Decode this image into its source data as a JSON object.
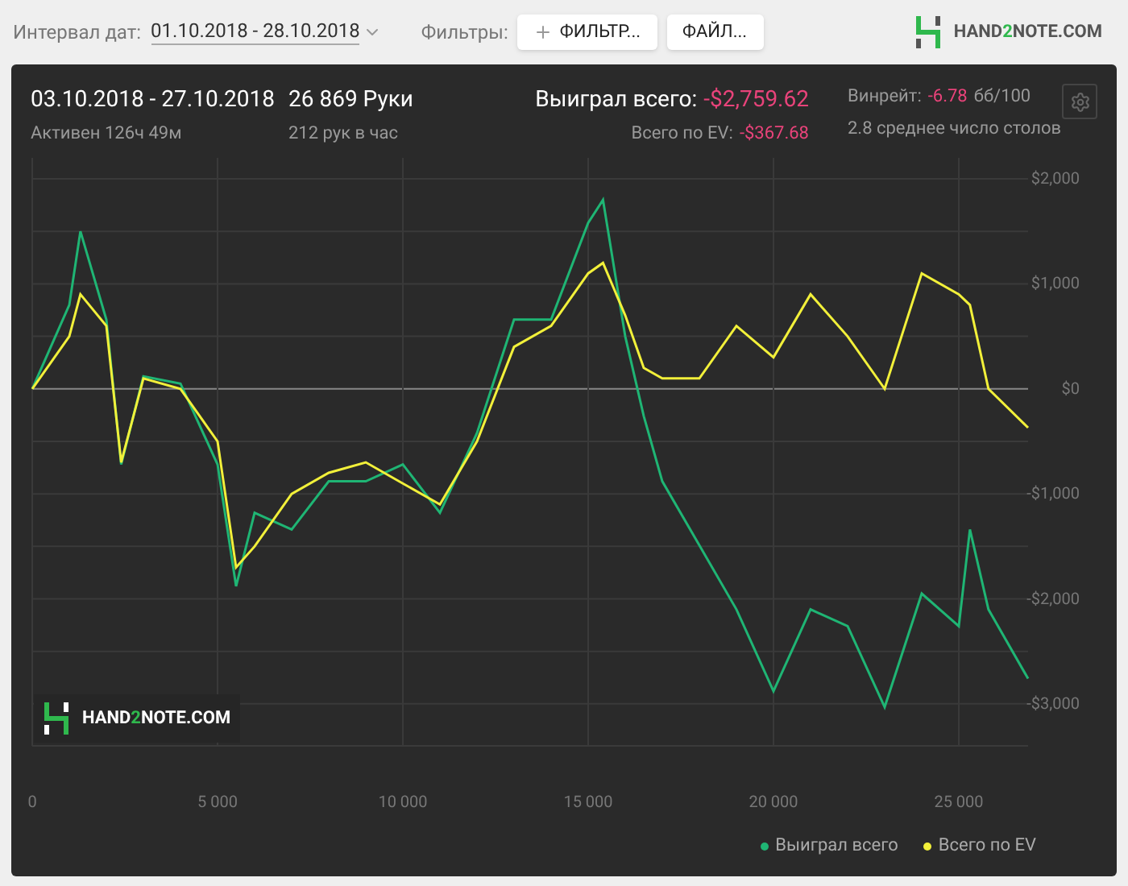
{
  "toolbar": {
    "date_label": "Интервал дат:",
    "date_range": "01.10.2018 - 28.10.2018",
    "filters_label": "Фильтры:",
    "buttons": [
      {
        "kind": "add",
        "label": "ФИЛЬТР..."
      },
      {
        "kind": "plain",
        "label": "ФАЙЛ..."
      }
    ],
    "logo": {
      "before": "HAND",
      "accent": "2",
      "after": "NOTE.COM"
    }
  },
  "summary": {
    "period": "03.10.2018 - 27.10.2018",
    "active": "Активен 126ч 49м",
    "hands": "26 869 Руки",
    "hands_rate": "212 рук в час",
    "won_label": "Выиграл всего:",
    "won_value": "-$2,759.62",
    "ev_label": "Всего по EV:",
    "ev_value": "-$367.68",
    "winrate_label": "Винрейт:",
    "winrate_value": "-6.78",
    "winrate_unit": "бб/100",
    "tables": "2.8 среднее число столов"
  },
  "chart": {
    "logo": {
      "before": "HAND",
      "accent": "2",
      "after": "NOTE.COM"
    },
    "chart_data": {
      "type": "line",
      "grid": true,
      "x": [
        0,
        1000,
        1300,
        2000,
        2400,
        3000,
        4000,
        5000,
        5500,
        6000,
        7000,
        8000,
        9000,
        10000,
        11000,
        12000,
        13000,
        14000,
        15000,
        15400,
        16000,
        16500,
        17000,
        18000,
        19000,
        20000,
        21000,
        22000,
        23000,
        24000,
        25000,
        25300,
        25800,
        26869
      ],
      "series": [
        {
          "name": "Выиграл всего",
          "color": "#1fb574",
          "values": [
            0,
            800,
            1500,
            660,
            -720,
            120,
            50,
            -720,
            -1880,
            -1180,
            -1340,
            -880,
            -880,
            -720,
            -1180,
            -420,
            660,
            660,
            1580,
            1800,
            500,
            -260,
            -880,
            -1490,
            -2100,
            -2880,
            -2100,
            -2260,
            -3030,
            -1950,
            -2260,
            -1340,
            -2100,
            -2760
          ]
        },
        {
          "name": "Всего по EV",
          "color": "#f2f03a",
          "values": [
            0,
            500,
            900,
            600,
            -700,
            100,
            0,
            -500,
            -1700,
            -1500,
            -1000,
            -800,
            -700,
            -900,
            -1100,
            -500,
            400,
            600,
            1100,
            1200,
            700,
            200,
            100,
            100,
            600,
            300,
            900,
            500,
            0,
            1100,
            900,
            800,
            0,
            -370
          ]
        }
      ],
      "xlim": [
        0,
        26869
      ],
      "ylim": [
        -3400,
        2200
      ],
      "xticks": [
        {
          "value": 0,
          "label": "0"
        },
        {
          "value": 5000,
          "label": "5 000"
        },
        {
          "value": 10000,
          "label": "10 000"
        },
        {
          "value": 15000,
          "label": "15 000"
        },
        {
          "value": 20000,
          "label": "20 000"
        },
        {
          "value": 25000,
          "label": "25 000"
        }
      ],
      "yticks": [
        {
          "value": 2000,
          "label": "$2,000"
        },
        {
          "value": 1000,
          "label": "$1,000"
        },
        {
          "value": 0,
          "label": "$0"
        },
        {
          "value": -1000,
          "label": "-$1,000"
        },
        {
          "value": -2000,
          "label": "-$2,000"
        },
        {
          "value": -3000,
          "label": "-$3,000"
        }
      ]
    }
  }
}
